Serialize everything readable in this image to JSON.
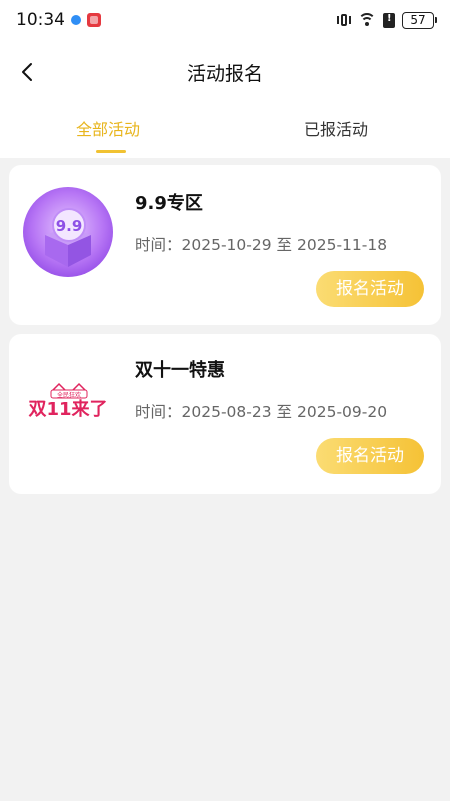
{
  "status_bar": {
    "time": "10:34",
    "battery": "57"
  },
  "header": {
    "title": "活动报名",
    "back_icon": "chevron-left-icon"
  },
  "tabs": [
    {
      "label": "全部活动",
      "active": true
    },
    {
      "label": "已报活动",
      "active": false
    }
  ],
  "colors": {
    "accent": "#e8b51d",
    "button": "#f5c236",
    "background": "#f2f2f2"
  },
  "activities": [
    {
      "name": "9.9专区",
      "time_label": "时间：",
      "start": "2025-10-29",
      "separator": "至",
      "end": "2025-11-18",
      "button": "报名活动",
      "thumb_text": "9.9",
      "thumb_icon": "purple-gift-box-icon"
    },
    {
      "name": "双十一特惠",
      "time_label": "时间：",
      "start": "2025-08-23",
      "separator": "至",
      "end": "2025-09-20",
      "button": "报名活动",
      "thumb_text": "双11来了",
      "thumb_subtext": "全民狂欢",
      "thumb_icon": "double-eleven-logo"
    }
  ]
}
